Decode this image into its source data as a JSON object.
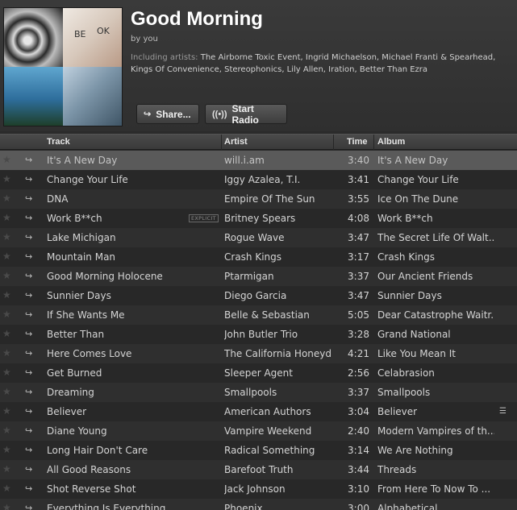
{
  "playlist": {
    "title": "Good Morning",
    "byline": "by you",
    "artists_label": "Including artists:",
    "artists_list": "The Airborne Toxic Event, Ingrid Michaelson, Michael Franti & Spearhead, Kings Of Convenience, Stereophonics, Lily Allen, Iration, Better Than Ezra",
    "cover_text_1": "BE",
    "cover_text_2": "OK"
  },
  "buttons": {
    "share": "Share...",
    "radio": "Start Radio",
    "share_icon": "share-arrow-icon",
    "radio_icon": "radio-broadcast-icon"
  },
  "columns": {
    "track": "Track",
    "artist": "Artist",
    "time": "Time",
    "album": "Album"
  },
  "tracks": [
    {
      "track": "It's A New Day",
      "artist": "will.i.am",
      "time": "3:40",
      "album": "It's A New Day"
    },
    {
      "track": "Change Your Life",
      "artist": "Iggy Azalea, T.I.",
      "time": "3:41",
      "album": "Change Your Life"
    },
    {
      "track": "DNA",
      "artist": "Empire Of The Sun",
      "time": "3:55",
      "album": "Ice On The Dune"
    },
    {
      "track": "Work B**ch",
      "explicit": "EXPLICIT",
      "artist": "Britney Spears",
      "time": "4:08",
      "album": "Work B**ch"
    },
    {
      "track": "Lake Michigan",
      "artist": "Rogue Wave",
      "time": "3:47",
      "album": "The Secret Life Of Walt..."
    },
    {
      "track": "Mountain Man",
      "artist": "Crash Kings",
      "time": "3:17",
      "album": "Crash Kings"
    },
    {
      "track": "Good Morning Holocene",
      "artist": "Ptarmigan",
      "time": "3:37",
      "album": "Our Ancient Friends"
    },
    {
      "track": "Sunnier Days",
      "artist": "Diego Garcia",
      "time": "3:47",
      "album": "Sunnier Days"
    },
    {
      "track": "If She Wants Me",
      "artist": "Belle & Sebastian",
      "time": "5:05",
      "album": "Dear Catastrophe Waitr..."
    },
    {
      "track": "Better Than",
      "artist": "John Butler Trio",
      "time": "3:28",
      "album": "Grand National"
    },
    {
      "track": "Here Comes Love",
      "artist": "The California Honeyd...",
      "time": "4:21",
      "album": "Like You Mean It"
    },
    {
      "track": "Get Burned",
      "artist": "Sleeper Agent",
      "time": "2:56",
      "album": "Celabrasion"
    },
    {
      "track": "Dreaming",
      "artist": "Smallpools",
      "time": "3:37",
      "album": "Smallpools"
    },
    {
      "track": "Believer",
      "artist": "American Authors",
      "time": "3:04",
      "album": "Believer"
    },
    {
      "track": "Diane Young",
      "artist": "Vampire Weekend",
      "time": "2:40",
      "album": "Modern Vampires of th..."
    },
    {
      "track": "Long Hair Don't Care",
      "artist": "Radical Something",
      "time": "3:14",
      "album": "We Are Nothing"
    },
    {
      "track": "All Good Reasons",
      "artist": "Barefoot Truth",
      "time": "3:44",
      "album": "Threads"
    },
    {
      "track": "Shot Reverse Shot",
      "artist": "Jack Johnson",
      "time": "3:10",
      "album": "From Here To Now To ..."
    },
    {
      "track": "Everything Is Everything",
      "artist": "Phoenix",
      "time": "3:00",
      "album": "Alphabetical"
    }
  ]
}
